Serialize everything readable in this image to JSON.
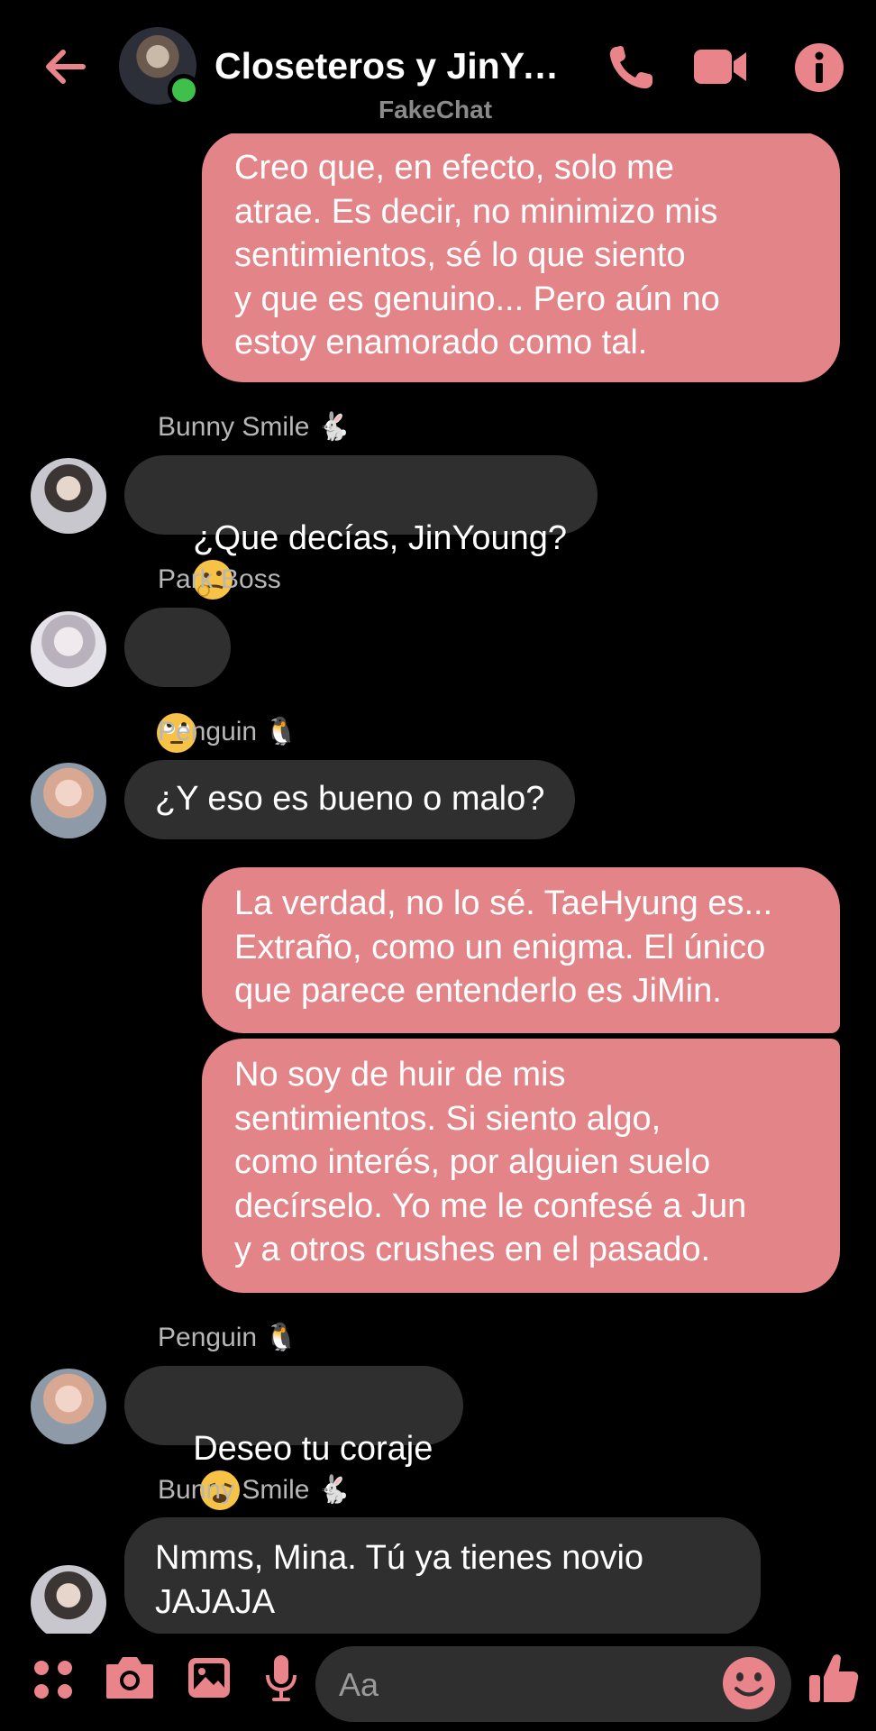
{
  "header": {
    "title": "Closeteros y JinYoung",
    "subtitle": "FakeChat"
  },
  "messages": [
    {
      "direction": "out",
      "text": "Creo que, en efecto, solo me\natrae. Es decir, no minimizo mis\nsentimientos, sé lo que siento\ny que es genuino... Pero aún no\nestoy enamorado como tal."
    },
    {
      "direction": "in",
      "sender": "Bunny Smile 🐇",
      "text": "¿Que decías, JinYoung?",
      "emoji": "thinking-face"
    },
    {
      "direction": "in",
      "sender": "Park Boss",
      "text": "",
      "emoji": "rolling-eyes"
    },
    {
      "direction": "in",
      "sender": "Penguin 🐧",
      "text": "¿Y eso es bueno o malo?"
    },
    {
      "direction": "out",
      "text": "La verdad, no lo sé. TaeHyung es...\nExtraño, como un enigma. El único\nque parece entenderlo es JiMin."
    },
    {
      "direction": "out",
      "text": "No soy de huir de mis\nsentimientos. Si siento algo,\ncomo interés, por alguien suelo\ndecírselo. Yo me le confesé a Jun\ny a otros crushes en el pasado."
    },
    {
      "direction": "in",
      "sender": "Penguin 🐧",
      "text": "Deseo tu coraje",
      "emoji": "weary-face + raised-fist"
    },
    {
      "direction": "in",
      "sender": "Bunny Smile 🐇",
      "text": "Nmms, Mina. Tú ya tienes novio\nJAJAJA"
    }
  ],
  "composer": {
    "placeholder": "Aa"
  },
  "colors": {
    "accent": "#e8848a",
    "outgoing_bubble": "#e38588",
    "incoming_bubble": "#2f2f2f",
    "online": "#3fc04a"
  }
}
